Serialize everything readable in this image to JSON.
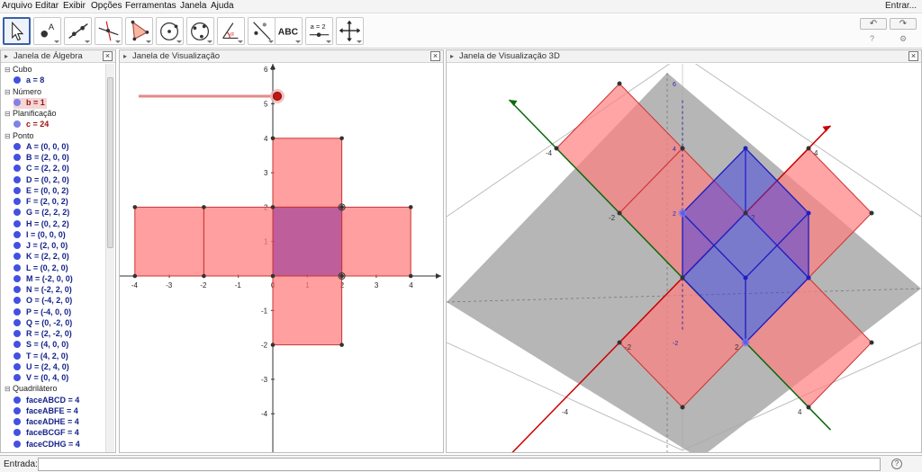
{
  "menu": [
    "Arquivo",
    "Editar",
    "Exibir",
    "Opções",
    "Ferramentas",
    "Janela",
    "Ajuda"
  ],
  "login": "Entrar...",
  "toolbar": {
    "tools": [
      "move-tool",
      "point-tool",
      "line-tool",
      "perpendicular-tool",
      "polygon-tool",
      "circle-tool",
      "conic-tool",
      "angle-tool",
      "reflect-tool",
      "text-tool",
      "slider-tool",
      "move-view-tool"
    ],
    "text_tool_label": "ABC",
    "slider_tool_label": "a = 2",
    "undo_label": "↶",
    "redo_label": "↷",
    "help_icon": "?",
    "settings_icon": "⚙"
  },
  "algebra": {
    "title": "Janela de Álgebra",
    "groups": [
      {
        "category": "Cubo",
        "items": [
          {
            "text": "a = 8",
            "style": "blue"
          }
        ]
      },
      {
        "category": "Número",
        "items": [
          {
            "text": "b = 1",
            "style": "red-selected"
          }
        ]
      },
      {
        "category": "Planificação",
        "items": [
          {
            "text": "c = 24",
            "style": "red"
          }
        ]
      },
      {
        "category": "Ponto",
        "items": [
          {
            "text": "A = (0, 0, 0)",
            "style": "blue"
          },
          {
            "text": "B = (2, 0, 0)",
            "style": "blue"
          },
          {
            "text": "C = (2, 2, 0)",
            "style": "blue"
          },
          {
            "text": "D = (0, 2, 0)",
            "style": "blue"
          },
          {
            "text": "E = (0, 0, 2)",
            "style": "blue"
          },
          {
            "text": "F = (2, 0, 2)",
            "style": "blue"
          },
          {
            "text": "G = (2, 2, 2)",
            "style": "blue"
          },
          {
            "text": "H = (0, 2, 2)",
            "style": "blue"
          },
          {
            "text": "I = (0, 0, 0)",
            "style": "blue"
          },
          {
            "text": "J = (2, 0, 0)",
            "style": "blue"
          },
          {
            "text": "K = (2, 2, 0)",
            "style": "blue"
          },
          {
            "text": "L = (0, 2, 0)",
            "style": "blue"
          },
          {
            "text": "M = (-2, 0, 0)",
            "style": "blue"
          },
          {
            "text": "N = (-2, 2, 0)",
            "style": "blue"
          },
          {
            "text": "O = (-4, 2, 0)",
            "style": "blue"
          },
          {
            "text": "P = (-4, 0, 0)",
            "style": "blue"
          },
          {
            "text": "Q = (0, -2, 0)",
            "style": "blue"
          },
          {
            "text": "R = (2, -2, 0)",
            "style": "blue"
          },
          {
            "text": "S = (4, 0, 0)",
            "style": "blue"
          },
          {
            "text": "T = (4, 2, 0)",
            "style": "blue"
          },
          {
            "text": "U = (2, 4, 0)",
            "style": "blue"
          },
          {
            "text": "V = (0, 4, 0)",
            "style": "blue"
          }
        ]
      },
      {
        "category": "Quadrilátero",
        "items": [
          {
            "text": "faceABCD = 4",
            "style": "blue"
          },
          {
            "text": "faceABFE = 4",
            "style": "blue"
          },
          {
            "text": "faceADHE = 4",
            "style": "blue"
          },
          {
            "text": "faceBCGF = 4",
            "style": "blue"
          },
          {
            "text": "faceCDHG = 4",
            "style": "blue"
          }
        ]
      }
    ]
  },
  "view2d": {
    "title": "Janela de Visualização",
    "x_ticks": [
      "-4",
      "-3",
      "-2",
      "-1",
      "0",
      "1",
      "2",
      "3",
      "4"
    ],
    "y_ticks": [
      "6",
      "5",
      "4",
      "3",
      "2",
      "1",
      "0",
      "-1",
      "-2",
      "-3",
      "-4"
    ],
    "slider_value": 1
  },
  "view3d": {
    "title": "Janela de Visualização 3D",
    "x_axis_labels": [
      "-4",
      "-2",
      "2",
      "4"
    ],
    "y_axis_labels": [
      "-4",
      "-2",
      "2",
      "4"
    ],
    "z_axis_labels": [
      "-2",
      "2",
      "4",
      "6"
    ]
  },
  "input": {
    "label": "Entrada:",
    "value": "",
    "help_icon": "?"
  },
  "colors": {
    "face_fill": "#ff7f7f",
    "face_stroke": "#cc3333",
    "base_fill": "#b74c8f",
    "cube_blue": "#3a3ae6",
    "axis_x": "#cc0000",
    "axis_y": "#006600"
  }
}
